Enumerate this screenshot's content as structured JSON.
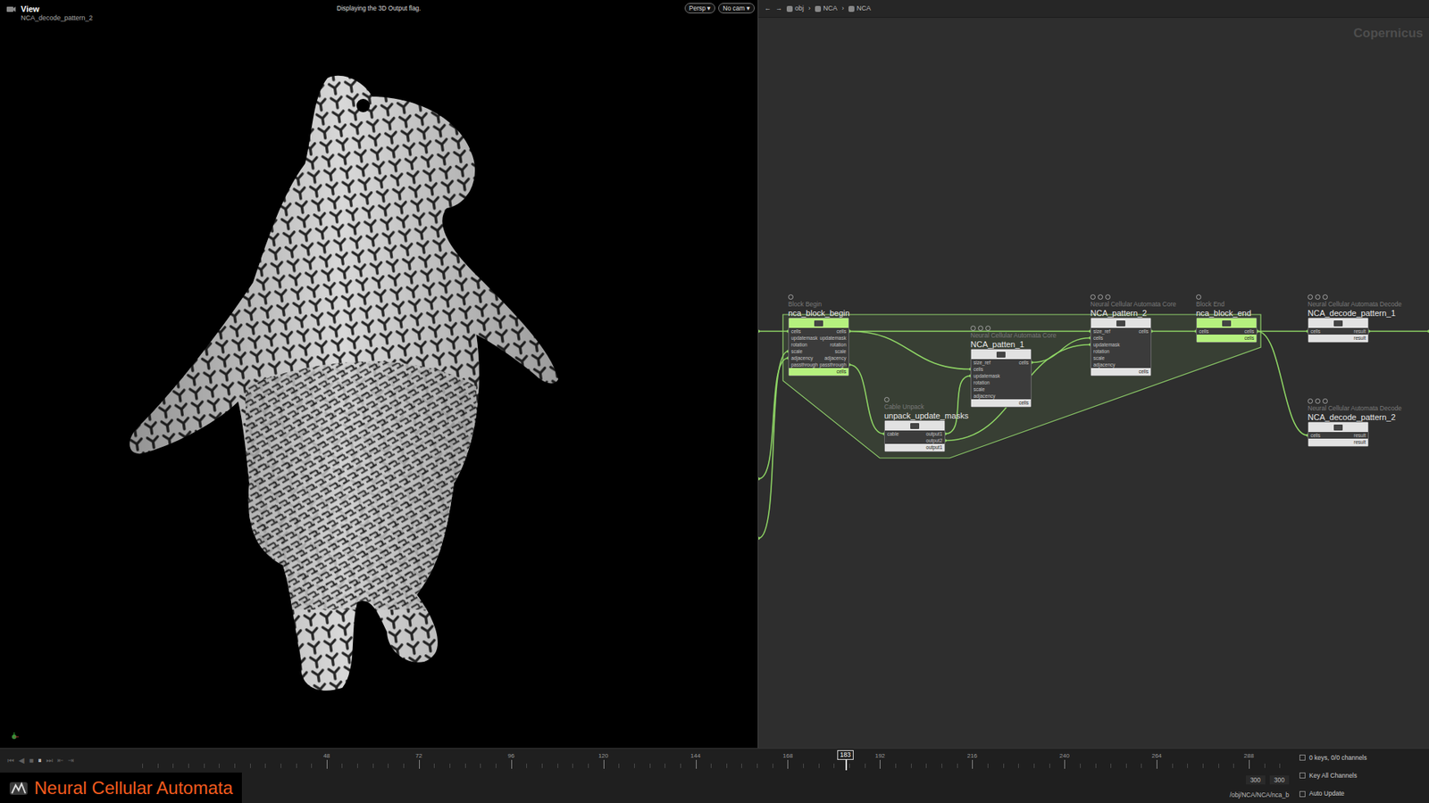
{
  "viewport": {
    "title": "View",
    "node": "NCA_decode_pattern_2",
    "message": "Displaying the 3D Output flag.",
    "buttons": [
      "Persp ▾",
      "No cam ▾"
    ]
  },
  "network": {
    "nav": [
      "←",
      "→"
    ],
    "separator": "›",
    "path": [
      "obj",
      "NCA",
      "NCA"
    ],
    "context": "Copernicus",
    "nodes": [
      {
        "type": "Block Begin",
        "name": "nca_block_begin",
        "kind": "block",
        "color": "#b5f07e",
        "inputs": [
          "cells",
          "updatemask",
          "rotation",
          "scale",
          "adjacency",
          "passthrough"
        ],
        "outputs": [
          "cells",
          "updatemask",
          "rotation",
          "scale",
          "adjacency",
          "passthrough"
        ],
        "footer": "cells"
      },
      {
        "type": "Neural Cellular Automata Core",
        "name": "NCA_patten_1",
        "kind": "core",
        "color": "#e2e2e2",
        "inputs": [
          "size_ref",
          "cells",
          "updatemask",
          "rotation",
          "scale",
          "adjacency"
        ],
        "outputs": [
          "cells"
        ],
        "footer": "cells"
      },
      {
        "type": "Cable Unpack",
        "name": "unpack_update_masks",
        "kind": "unpack",
        "color": "#e2e2e2",
        "inputs": [
          "cable"
        ],
        "outputs": [
          "output1",
          "output2"
        ],
        "footer": "output1"
      },
      {
        "type": "Neural Cellular Automata Core",
        "name": "NCA_pattern_2",
        "kind": "core",
        "color": "#e2e2e2",
        "inputs": [
          "size_ref",
          "cells",
          "updatemask",
          "rotation",
          "scale",
          "adjacency"
        ],
        "outputs": [
          "cells"
        ],
        "footer": "cells"
      },
      {
        "type": "Block End",
        "name": "nca_block_end",
        "kind": "block",
        "color": "#b5f07e",
        "inputs": [
          "cells"
        ],
        "outputs": [
          "cells"
        ],
        "footer": "cells"
      },
      {
        "type": "Neural Cellular Automata Decode",
        "name": "NCA_decode_pattern_1",
        "kind": "decode",
        "color": "#e2e2e2",
        "inputs": [
          "cells"
        ],
        "outputs": [
          "result"
        ],
        "footer": "result"
      },
      {
        "type": "Neural Cellular Automata Decode",
        "name": "NCA_decode_pattern_2",
        "kind": "decode",
        "color": "#e2e2e2",
        "inputs": [
          "cells"
        ],
        "outputs": [
          "result"
        ],
        "footer": "result"
      }
    ]
  },
  "timeline": {
    "controls": [
      {
        "label": "⏮",
        "selected": false
      },
      {
        "label": "◀",
        "selected": false
      },
      {
        "label": "■",
        "selected": false
      },
      {
        "label": "⏸",
        "selected": true
      },
      {
        "label": "⏭",
        "selected": false
      },
      {
        "label": "⇤",
        "selected": false
      },
      {
        "label": "⇥",
        "selected": false
      }
    ],
    "ticks": [
      "48",
      "72",
      "96",
      "120",
      "144",
      "168",
      "192",
      "216",
      "240",
      "264",
      "288"
    ],
    "frame": "183",
    "start": "300",
    "end": "300",
    "keys": "0 keys, 0/0 channels",
    "key_all": "Key All Channels",
    "path": "/obj/NCA/NCA/nca_b",
    "auto_update": "Auto Update"
  },
  "banner": "Neural Cellular Automata"
}
